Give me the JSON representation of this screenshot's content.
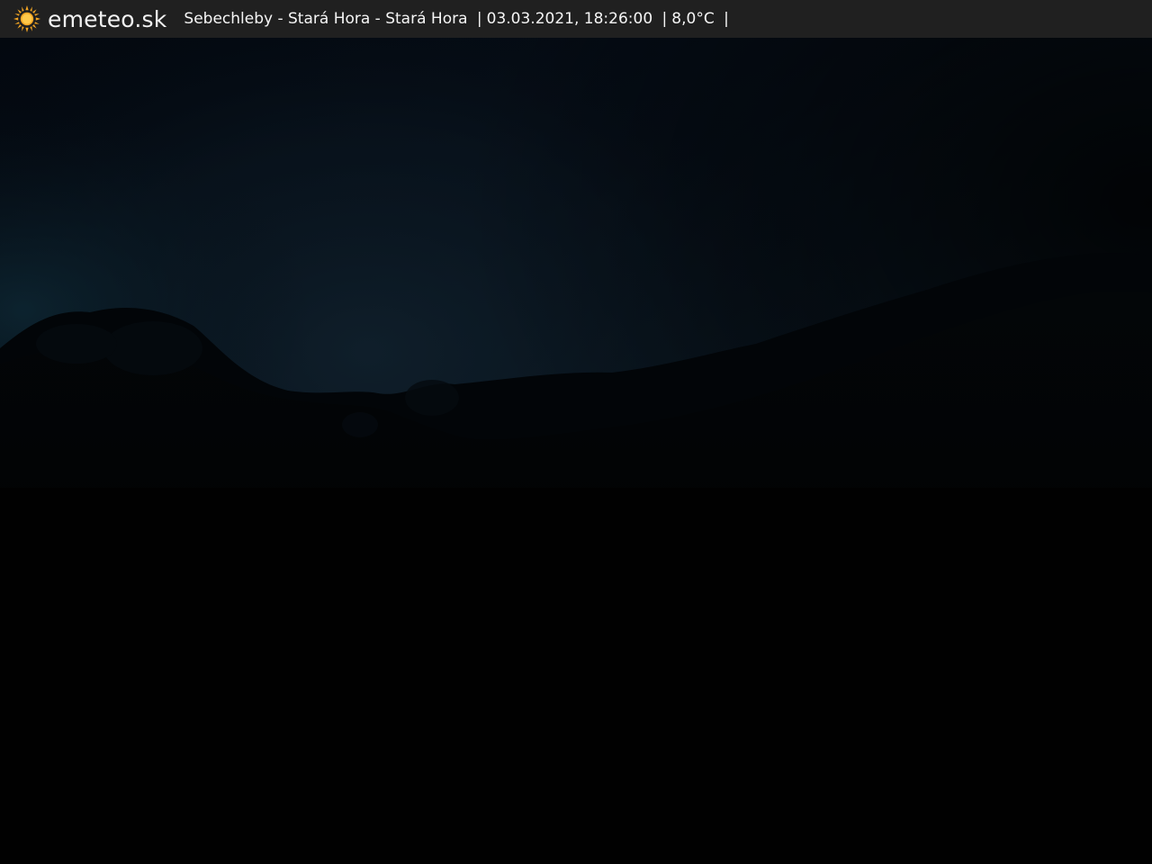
{
  "branding": {
    "site_name": "emeteo.sk",
    "logo_icon": "sun-icon",
    "accent_color": "#f5a623"
  },
  "caption": {
    "location": "Sebechleby - Stará Hora - Stará Hora",
    "separator": "|",
    "datetime": "03.03.2021, 18:26:00",
    "temperature": "8,0°C"
  },
  "scene": {
    "description_icon": "webcam-night-landscape"
  }
}
